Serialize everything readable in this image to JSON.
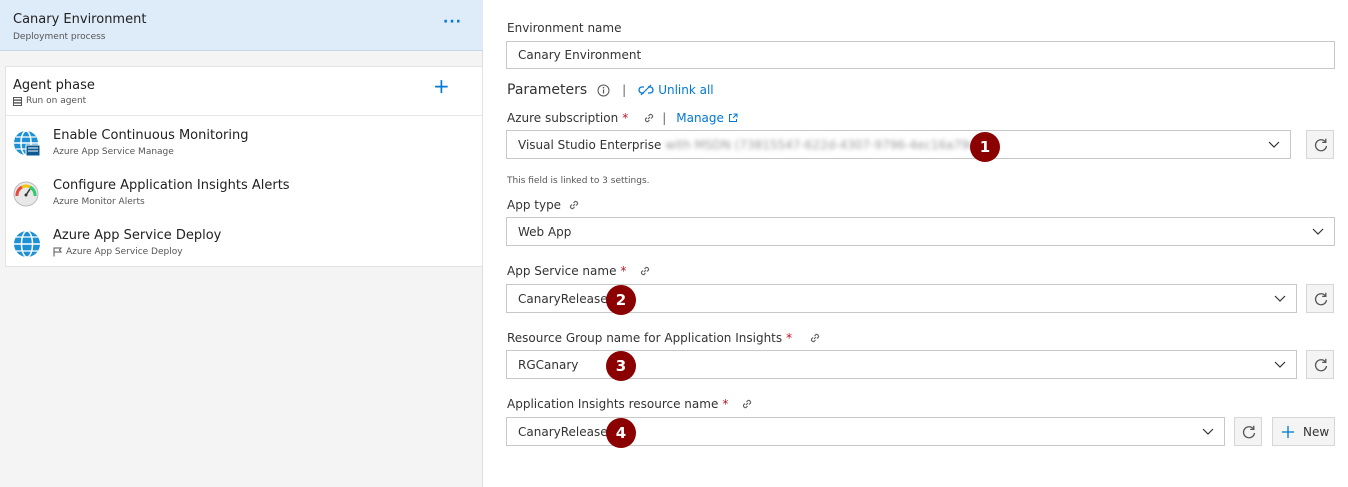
{
  "left": {
    "environment": {
      "title": "Canary Environment",
      "subtitle": "Deployment process",
      "more": "···"
    },
    "phase": {
      "title": "Agent phase",
      "subtitle": "Run on agent",
      "add": "+"
    },
    "tasks": [
      {
        "name": "Enable Continuous Monitoring",
        "sub": "Azure App Service Manage",
        "icon": "app-service-globe-icon"
      },
      {
        "name": "Configure Application Insights Alerts",
        "sub": "Azure Monitor Alerts",
        "icon": "gauge-icon"
      },
      {
        "name": "Azure App Service Deploy",
        "sub": "Azure App Service Deploy",
        "icon": "app-service-globe-icon"
      }
    ]
  },
  "right": {
    "env_name": {
      "label": "Environment name",
      "value": "Canary Environment"
    },
    "parameters": {
      "heading": "Parameters",
      "separator": "|",
      "unlink": "Unlink all"
    },
    "subscription": {
      "label": "Azure subscription",
      "required": "*",
      "separator": "|",
      "manage": "Manage",
      "value": "Visual Studio Enterprise",
      "value_blurred": "with MSDN (73815547-622d-4307-9796-4ec16a79cfbc)",
      "hint": "This field is linked to 3 settings.",
      "badge": "1"
    },
    "app_type": {
      "label": "App type",
      "value": "Web App"
    },
    "app_service": {
      "label": "App Service name",
      "required": "*",
      "value": "CanaryRelease",
      "badge": "2"
    },
    "resource_group": {
      "label": "Resource Group name for Application Insights",
      "required": "*",
      "value": "RGCanary",
      "badge": "3"
    },
    "insights": {
      "label": "Application Insights resource name",
      "required": "*",
      "value": "CanaryRelease",
      "badge": "4",
      "new_label": "New"
    }
  },
  "colors": {
    "accent": "#0078d4",
    "badge": "#8b0000",
    "selected": "#deecf9"
  }
}
